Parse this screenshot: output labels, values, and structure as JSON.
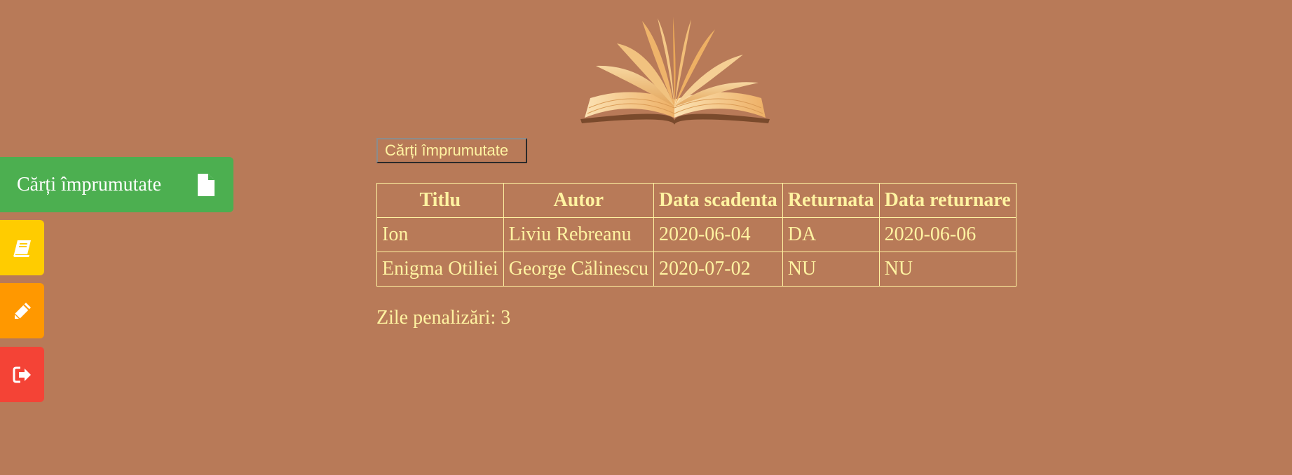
{
  "colors": {
    "background": "#b87a58",
    "text": "#fff3a1",
    "nav_green": "#4caf50",
    "nav_yellow": "#ffcc00",
    "nav_orange": "#ff9800",
    "nav_red": "#f44336"
  },
  "sidenav": {
    "items": [
      {
        "label": "Cărți împrumutate",
        "icon": "document-icon",
        "expanded": true
      },
      {
        "label": "",
        "icon": "book-icon",
        "expanded": false
      },
      {
        "label": "",
        "icon": "pencil-icon",
        "expanded": false
      },
      {
        "label": "",
        "icon": "sign-out-icon",
        "expanded": false
      }
    ]
  },
  "main": {
    "header_image": "open-book-illustration",
    "tab_button_label": "Cărți împrumutate",
    "table": {
      "headers": [
        "Titlu",
        "Autor",
        "Data scadenta",
        "Returnata",
        "Data returnare"
      ],
      "rows": [
        [
          "Ion",
          "Liviu Rebreanu",
          "2020-06-04",
          "DA",
          "2020-06-06"
        ],
        [
          "Enigma Otiliei",
          "George Călinescu",
          "2020-07-02",
          "NU",
          "NU"
        ]
      ]
    },
    "penalty_text": "Zile penalizări: 3"
  }
}
